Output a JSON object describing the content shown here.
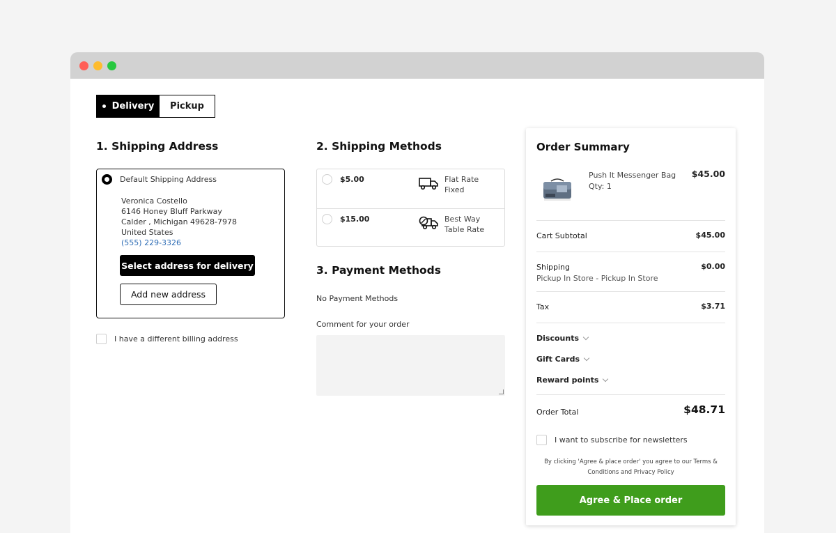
{
  "window": {
    "controls": [
      "close",
      "minimize",
      "maximize"
    ]
  },
  "delivery_toggle": {
    "options": [
      {
        "label": "Delivery",
        "active": true
      },
      {
        "label": "Pickup",
        "active": false
      }
    ]
  },
  "shipping_address": {
    "heading": "1. Shipping Address",
    "card_title": "Default Shipping Address",
    "name": "Veronica Costello",
    "street": "6146 Honey Bluff Parkway",
    "city_line": "Calder , Michigan 49628-7978",
    "country": "United States",
    "phone": "(555) 229-3326",
    "select_button": "Select address for delivery",
    "add_button": "Add new address",
    "billing_checkbox_label": "I have a different billing address"
  },
  "shipping_methods": {
    "heading": "2. Shipping Methods",
    "options": [
      {
        "price": "$5.00",
        "name": "Flat Rate",
        "sub": "Fixed",
        "icon": "truck-icon"
      },
      {
        "price": "$15.00",
        "name": "Best Way",
        "sub": "Table Rate",
        "icon": "truck-badge-icon"
      }
    ]
  },
  "payment_methods": {
    "heading": "3. Payment Methods",
    "empty_text": "No Payment Methods",
    "comment_label": "Comment for your order",
    "comment_value": ""
  },
  "order_summary": {
    "title": "Order Summary",
    "product": {
      "name": "Push It Messenger Bag",
      "qty": "Qty: 1",
      "price": "$45.00"
    },
    "cart_subtotal_label": "Cart Subtotal",
    "cart_subtotal_value": "$45.00",
    "shipping_label": "Shipping",
    "shipping_method": "Pickup In Store - Pickup In Store",
    "shipping_value": "$0.00",
    "tax_label": "Tax",
    "tax_value": "$3.71",
    "discounts_label": "Discounts",
    "gift_cards_label": "Gift Cards",
    "reward_points_label": "Reward points",
    "order_total_label": "Order Total",
    "order_total_value": "$48.71",
    "newsletter_label": "I want to subscribe for newsletters",
    "terms_line1": "By clicking 'Agree & place order' you agree to our Terms &",
    "terms_line2": "Conditions and Privacy Policy",
    "place_order_button": "Agree & Place order"
  },
  "colors": {
    "accent_green": "#3f9d1c",
    "link_blue": "#2d6cb5",
    "titlebar": "#d2d2d2"
  }
}
